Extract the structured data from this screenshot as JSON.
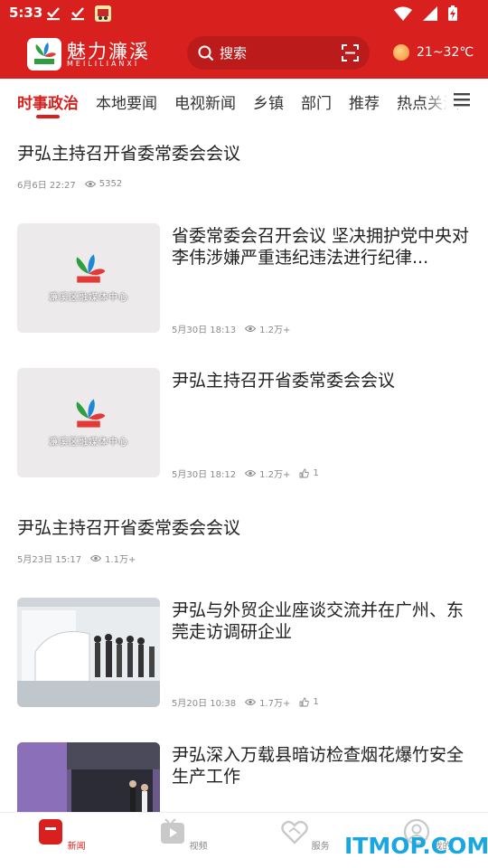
{
  "status_bar": {
    "time": "5:33"
  },
  "header": {
    "app_name": "魅力濂溪",
    "app_subtitle": "MEILILIANXI",
    "search_placeholder": "搜索",
    "weather": "21~32℃"
  },
  "tabs": [
    {
      "label": "时事政治",
      "active": true
    },
    {
      "label": "本地要闻"
    },
    {
      "label": "电视新闻"
    },
    {
      "label": "乡镇"
    },
    {
      "label": "部门"
    },
    {
      "label": "推荐"
    },
    {
      "label": "热点关注"
    }
  ],
  "feed": {
    "placeholder_text": "濂溪区融媒体中心",
    "items": [
      {
        "title": "尹弘主持召开省委常委会会议",
        "date": "6月6日 22:27",
        "views": "5352"
      },
      {
        "title": "省委常委会召开会议 坚决拥护党中央对李伟涉嫌严重违纪违法进行纪律...",
        "date": "5月30日 18:13",
        "views": "1.2万+"
      },
      {
        "title": "尹弘主持召开省委常委会会议",
        "date": "5月30日 18:12",
        "views": "1.2万+",
        "likes": "1"
      },
      {
        "title": "尹弘主持召开省委常委会会议",
        "date": "5月23日 15:17",
        "views": "1.1万+"
      },
      {
        "title": "尹弘与外贸企业座谈交流并在广州、东莞走访调研企业",
        "date": "5月20日 10:38",
        "views": "1.7万+",
        "likes": "1"
      },
      {
        "title": "尹弘深入万载县暗访检查烟花爆竹安全生产工作"
      }
    ]
  },
  "bottom_nav": [
    {
      "label": "新闻",
      "active": true
    },
    {
      "label": "视频"
    },
    {
      "label": "服务"
    },
    {
      "label": "我的"
    }
  ],
  "watermark": "ITMOP.COM",
  "colors": {
    "brand_red": "#d8201f",
    "meta_gray": "#8a8a8a",
    "watermark_blue": "#1aa7e0"
  }
}
